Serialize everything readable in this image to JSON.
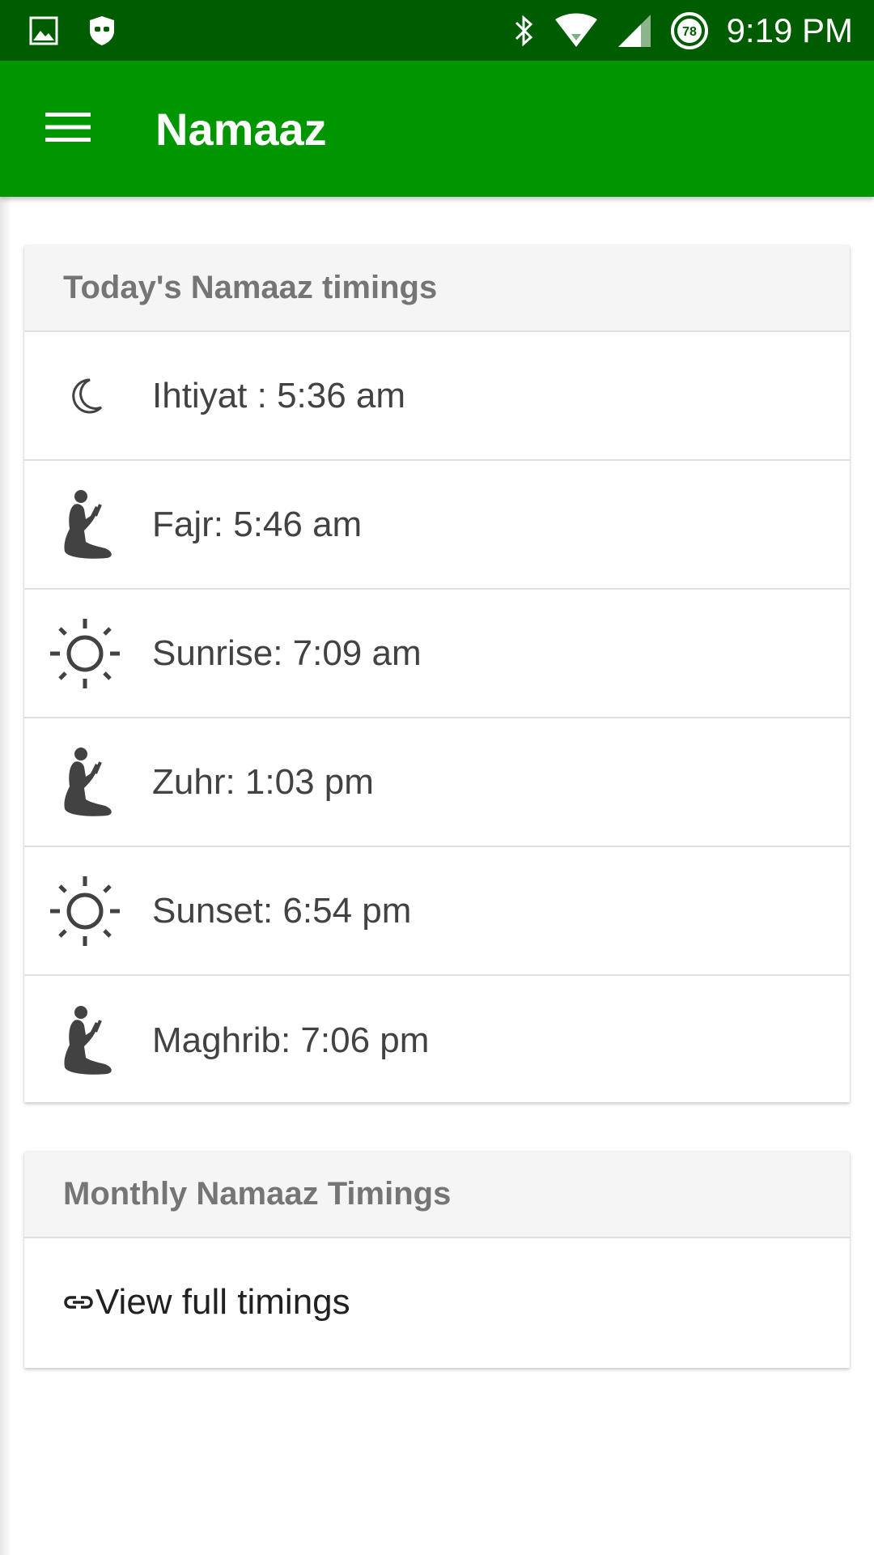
{
  "status_bar": {
    "time": "9:19 PM",
    "battery_level": "78",
    "icons": [
      "image-icon",
      "shield-icon",
      "bluetooth-icon",
      "wifi-icon",
      "signal-icon",
      "battery-icon"
    ]
  },
  "app_bar": {
    "title": "Namaaz",
    "menu_icon": "hamburger-menu-icon"
  },
  "colors": {
    "status_bar": "#005c00",
    "app_bar": "#009600",
    "card_header_bg": "#f5f5f5",
    "icon": "#424242"
  },
  "today_card": {
    "header": "Today's Namaaz timings",
    "rows": [
      {
        "icon": "moon-icon",
        "text": "Ihtiyat : 5:36 am"
      },
      {
        "icon": "prayer-icon",
        "text": "Fajr: 5:46 am"
      },
      {
        "icon": "sun-icon",
        "text": "Sunrise: 7:09 am"
      },
      {
        "icon": "prayer-icon",
        "text": "Zuhr: 1:03 pm"
      },
      {
        "icon": "sun-icon",
        "text": "Sunset: 6:54 pm"
      },
      {
        "icon": "prayer-icon",
        "text": "Maghrib: 7:06 pm"
      }
    ]
  },
  "monthly_card": {
    "header": "Monthly Namaaz Timings",
    "link_icon": "link-icon",
    "link_text": "View full timings"
  }
}
